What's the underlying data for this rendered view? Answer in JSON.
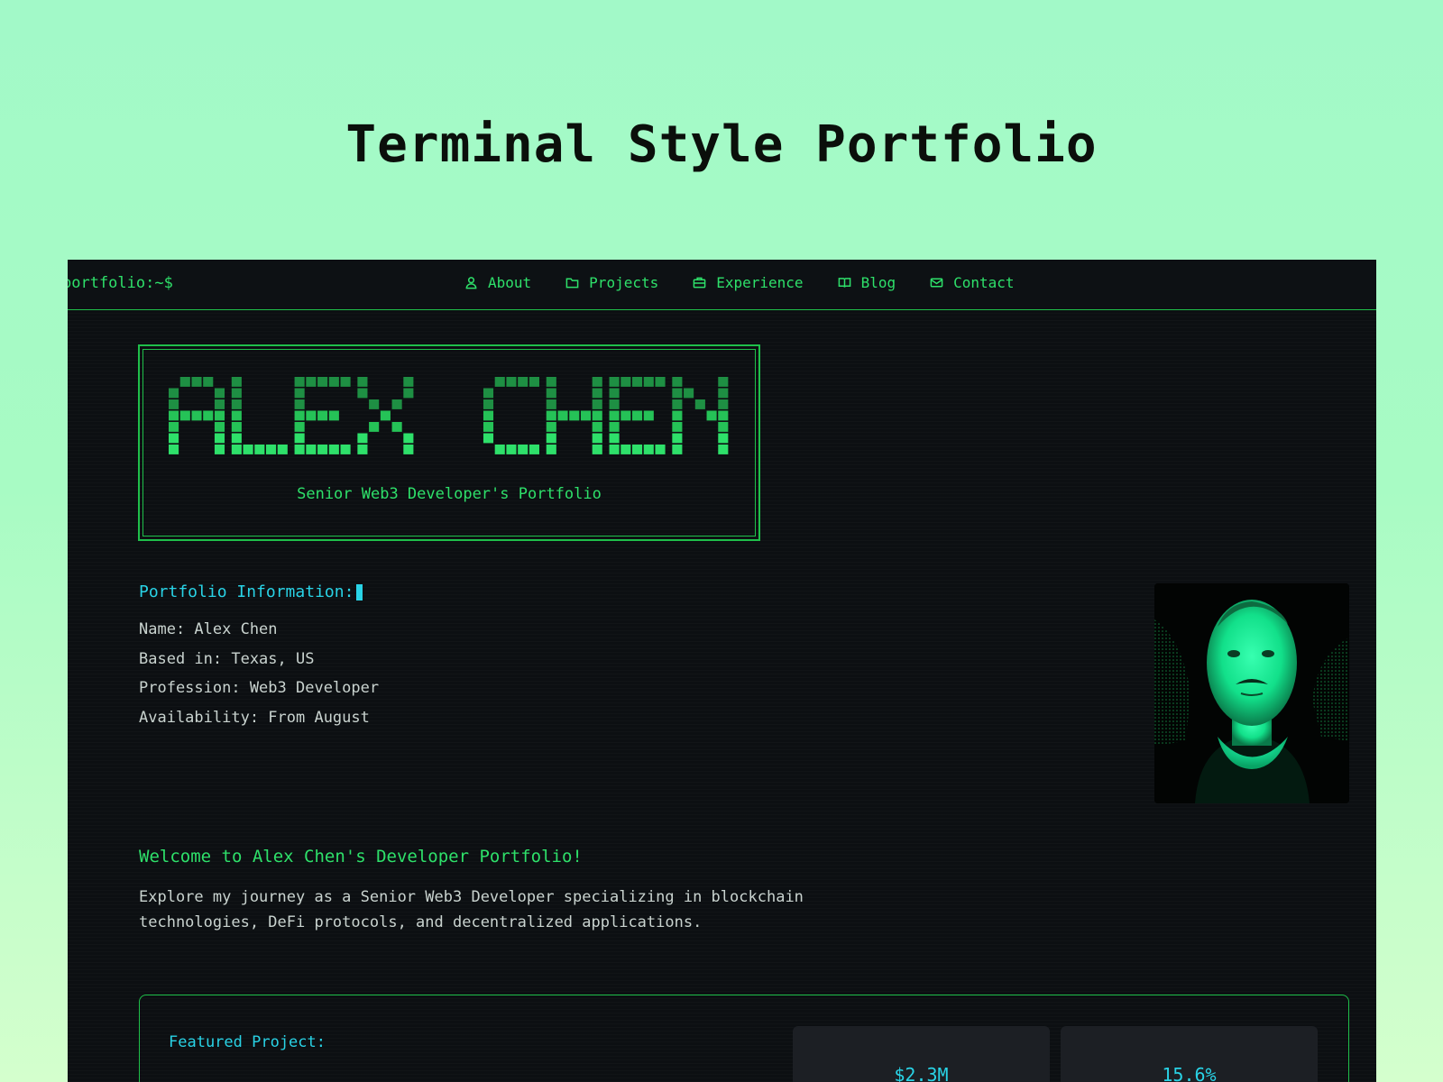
{
  "page": {
    "title": "Terminal Style Portfolio"
  },
  "navbar": {
    "prompt": "portfolio:~$",
    "items": [
      {
        "label": "About",
        "icon": "user-icon"
      },
      {
        "label": "Projects",
        "icon": "folder-icon"
      },
      {
        "label": "Experience",
        "icon": "briefcase-icon"
      },
      {
        "label": "Blog",
        "icon": "book-icon"
      },
      {
        "label": "Contact",
        "icon": "mail-icon"
      }
    ]
  },
  "hero": {
    "name": "ALEX CHEN",
    "subtitle": "Senior Web3 Developer's Portfolio"
  },
  "info": {
    "heading": "Portfolio Information:",
    "rows": [
      "Name: Alex Chen",
      "Based in: Texas, US",
      "Profession: Web3 Developer",
      "Availability: From August"
    ]
  },
  "welcome": {
    "title": "Welcome to Alex Chen's Developer Portfolio!",
    "text": "Explore my journey as a Senior Web3 Developer specializing in blockchain technologies, DeFi protocols, and decentralized applications."
  },
  "featured": {
    "label": "Featured Project:",
    "stats": [
      {
        "value": "$2.3M"
      },
      {
        "value": "15.6%"
      }
    ]
  },
  "colors": {
    "accent_green": "#2ee06a",
    "accent_cyan": "#29d3e6",
    "terminal_bg": "#0c0f12",
    "page_bg": "#a8fbc4"
  }
}
